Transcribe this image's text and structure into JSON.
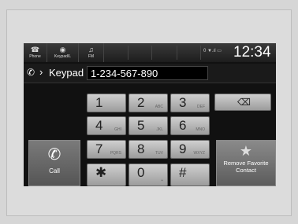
{
  "status_bar": {
    "buttons": [
      {
        "label": "Phone",
        "icon": "phone-icon",
        "glyph": "☎"
      },
      {
        "label": "Keypad/L",
        "icon": "keypad-icon",
        "glyph": "◉"
      },
      {
        "label": "FM",
        "icon": "radio-icon",
        "glyph": "♫"
      }
    ],
    "signal": "0 ▼.ıl ▭",
    "time": "12:34"
  },
  "header": {
    "phone_glyph": "✆",
    "chevron": "›",
    "title": "Keypad",
    "number": "1-234-567-890"
  },
  "keypad": {
    "keys": [
      {
        "digit": "1",
        "letters": ""
      },
      {
        "digit": "2",
        "letters": "ABC"
      },
      {
        "digit": "3",
        "letters": "DEF"
      },
      {
        "digit": "4",
        "letters": "GHI"
      },
      {
        "digit": "5",
        "letters": "JKL"
      },
      {
        "digit": "6",
        "letters": "MNO"
      },
      {
        "digit": "7",
        "letters": "PQRS"
      },
      {
        "digit": "8",
        "letters": "TUV"
      },
      {
        "digit": "9",
        "letters": "WXYZ"
      },
      {
        "digit": "✱",
        "letters": ""
      },
      {
        "digit": "0",
        "letters": "+"
      },
      {
        "digit": "#",
        "letters": ""
      }
    ]
  },
  "actions": {
    "delete_glyph": "⌫",
    "call_label": "Call",
    "call_glyph": "✆",
    "favorite_label": "Remove Favorite Contact",
    "favorite_glyph": "★"
  }
}
